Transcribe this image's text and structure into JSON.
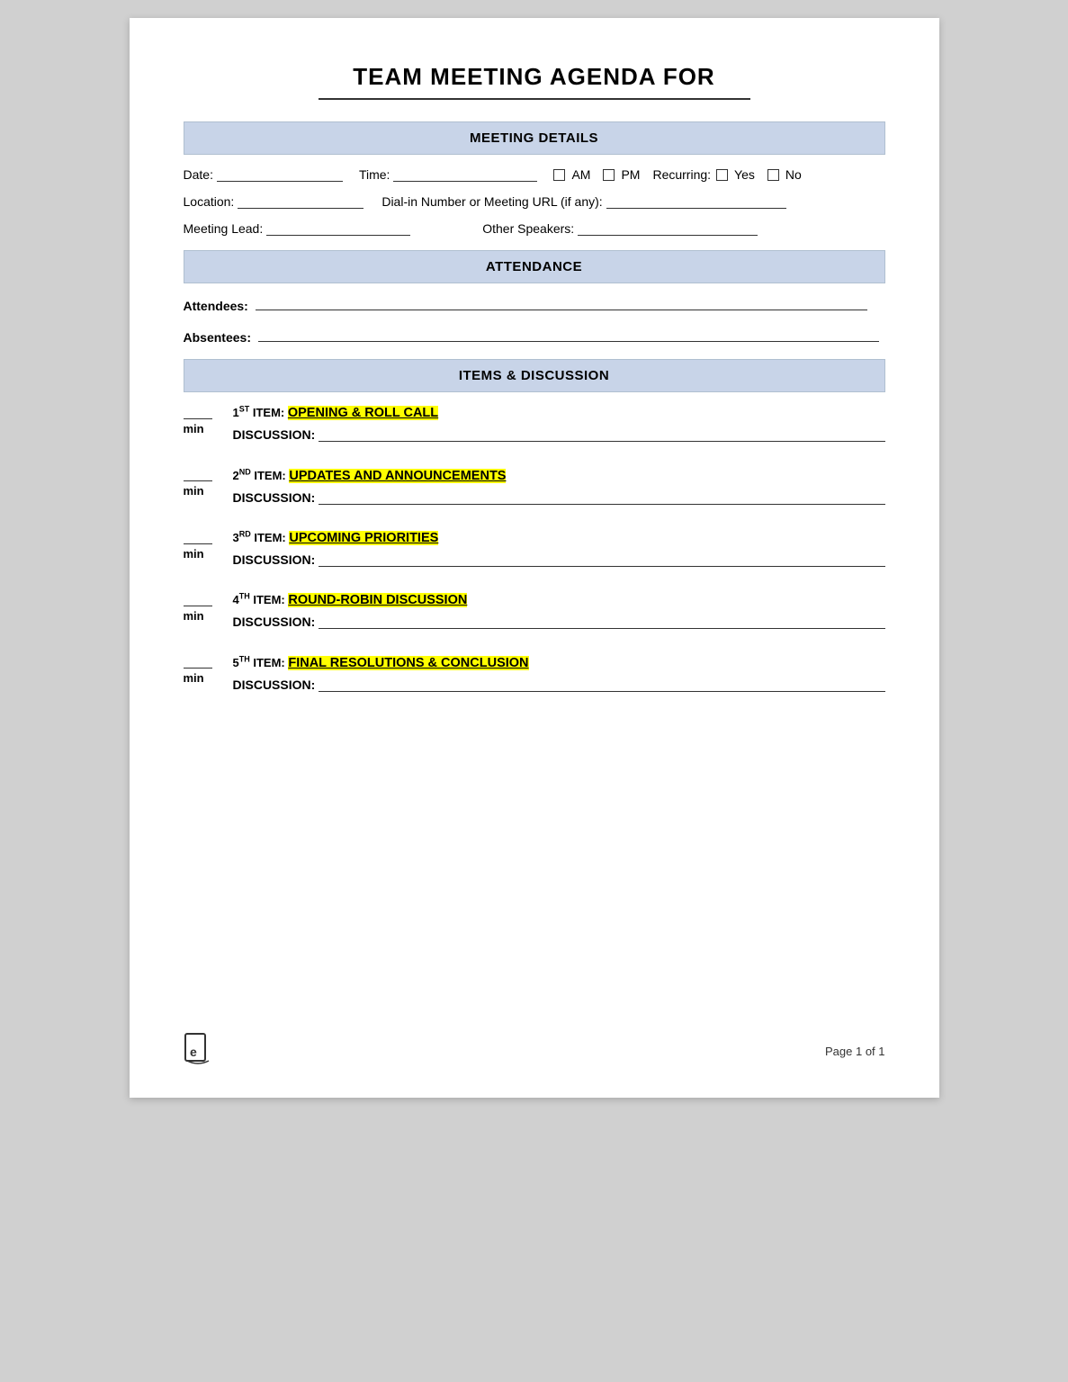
{
  "page": {
    "title": "TEAM MEETING AGENDA FOR",
    "footer": {
      "page_label": "Page 1 of 1"
    }
  },
  "sections": {
    "meeting_details": {
      "header": "MEETING DETAILS",
      "date_label": "Date:",
      "time_label": "Time:",
      "am_label": "AM",
      "pm_label": "PM",
      "recurring_label": "Recurring:",
      "yes_label": "Yes",
      "no_label": "No",
      "location_label": "Location:",
      "dialin_label": "Dial-in Number or Meeting URL (if any):",
      "meeting_lead_label": "Meeting Lead:",
      "other_speakers_label": "Other Speakers:"
    },
    "attendance": {
      "header": "ATTENDANCE",
      "attendees_label": "Attendees:",
      "absentees_label": "Absentees"
    },
    "items_discussion": {
      "header": "ITEMS & DISCUSSION",
      "items": [
        {
          "number": "1",
          "ordinal": "ST",
          "title": "OPENING & ROLL CALL",
          "discussion_label": "DISCUSSION:"
        },
        {
          "number": "2",
          "ordinal": "ND",
          "title": "UPDATES AND ANNOUNCEMENTS",
          "discussion_label": "DISCUSSION:"
        },
        {
          "number": "3",
          "ordinal": "RD",
          "title": "UPCOMING PRIORITIES",
          "discussion_label": "DISCUSSION:"
        },
        {
          "number": "4",
          "ordinal": "TH",
          "title": "ROUND-ROBIN DISCUSSION",
          "discussion_label": "DISCUSSION:"
        },
        {
          "number": "5",
          "ordinal": "TH",
          "title": "FINAL RESOLUTIONS & CONCLUSION",
          "discussion_label": "DISCUSSION:"
        }
      ],
      "min_label": "min",
      "item_prefix": "ITEM:"
    }
  }
}
